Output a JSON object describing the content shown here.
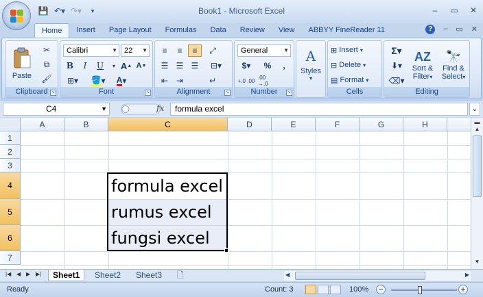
{
  "window": {
    "title": "Book1 - Microsoft Excel",
    "min": "‒",
    "max": "▭",
    "close": "✕"
  },
  "ribbon_tabs": [
    "Home",
    "Insert",
    "Page Layout",
    "Formulas",
    "Data",
    "Review",
    "View",
    "ABBYY FineReader 11"
  ],
  "ribbon": {
    "clipboard": {
      "label": "Clipboard",
      "paste": "Paste"
    },
    "font": {
      "label": "Font",
      "name": "Calibri",
      "size": "22",
      "bold": "B",
      "italic": "I",
      "underline": "U"
    },
    "alignment": {
      "label": "Alignment"
    },
    "number": {
      "label": "Number",
      "format": "General",
      "currency": "$",
      "percent": "%",
      "comma": ","
    },
    "styles": {
      "label": "Styles"
    },
    "cells": {
      "label": "Cells",
      "insert": "Insert",
      "delete": "Delete",
      "format": "Format"
    },
    "editing": {
      "label": "Editing",
      "sort_filter_1": "Sort &",
      "sort_filter_2": "Filter",
      "find_select_1": "Find &",
      "find_select_2": "Select"
    }
  },
  "formula_bar": {
    "name_box": "C4",
    "fx": "fx",
    "content": "formula excel"
  },
  "columns": [
    "A",
    "B",
    "C",
    "D",
    "E",
    "F",
    "G",
    "H"
  ],
  "rows": [
    "1",
    "2",
    "3",
    "4",
    "5",
    "6",
    "7"
  ],
  "cells": {
    "C4": "formula excel",
    "C5": "rumus excel",
    "C6": "fungsi excel"
  },
  "sheets": [
    "Sheet1",
    "Sheet2",
    "Sheet3"
  ],
  "status": {
    "ready": "Ready",
    "count": "Count: 3",
    "zoom": "100%"
  }
}
